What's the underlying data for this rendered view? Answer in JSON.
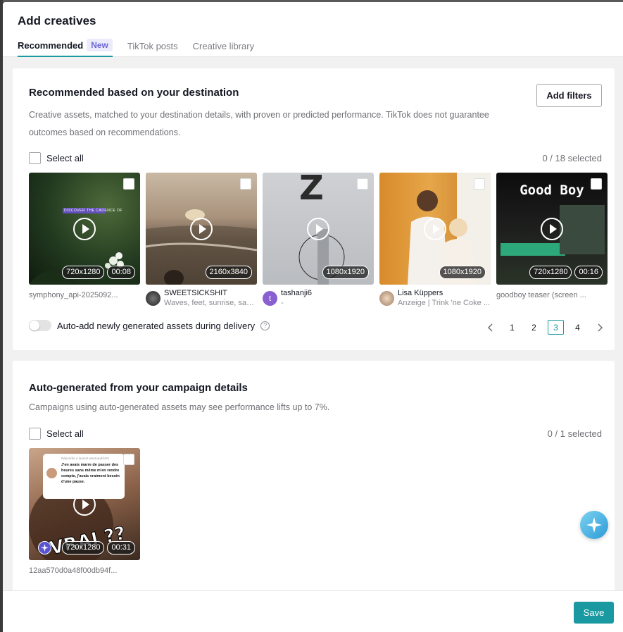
{
  "modal": {
    "title": "Add creatives",
    "tabs": [
      {
        "label": "Recommended",
        "badge": "New",
        "active": true
      },
      {
        "label": "TikTok posts"
      },
      {
        "label": "Creative library"
      }
    ]
  },
  "recommended": {
    "title": "Recommended based on your destination",
    "description": "Creative assets, matched to your destination details, with proven or predicted performance. TikTok does not guarantee outcomes based on recommendations.",
    "add_filters_label": "Add filters",
    "select_all_label": "Select all",
    "selected_count": "0 / 18 selected",
    "items": [
      {
        "resolution": "720x1280",
        "duration": "00:08",
        "name": "symphony_api-2025092..."
      },
      {
        "resolution": "2160x3840",
        "author": "SWEETSICKSHIT",
        "caption": "Waves, feet, sunrise, san..."
      },
      {
        "resolution": "1080x1920",
        "author": "tashanji6",
        "caption": "-",
        "avatar_letter": "t"
      },
      {
        "resolution": "1080x1920",
        "author": "Lisa Küppers",
        "caption": "Anzeige | Trink 'ne Coke ..."
      },
      {
        "resolution": "720x1280",
        "duration": "00:16",
        "name": "goodboy teaser (screen ..."
      }
    ],
    "overlay_text": {
      "item0": "DISCOVER THE CADENCE OF",
      "item4_headline": "Good Boy",
      "item2_letter": "Z"
    },
    "auto_add_label": "Auto-add newly generated assets during delivery",
    "pagination": {
      "pages": [
        "1",
        "2",
        "3",
        "4"
      ],
      "current": "3"
    }
  },
  "autogen": {
    "title": "Auto-generated from your campaign details",
    "description": "Campaigns using auto-generated assets may see performance lifts up to 7%.",
    "select_all_label": "Select all",
    "selected_count": "0 / 1 selected",
    "items": [
      {
        "resolution": "720x1280",
        "duration": "00:31",
        "name": "12aa570d0a48f00db94f...",
        "bubble_reply": "Répondre à laurent.wantorpdd431",
        "bubble_text": "J'en avais marre de passer des heures sans même m'en rendre compte, j'avais vraiment besoin d'une pause.",
        "big_text": "VRAI ??"
      }
    ]
  },
  "footer": {
    "save_label": "Save"
  },
  "colors": {
    "accent": "#1a9aa0",
    "badge_text": "#6b67d6",
    "badge_bg": "#ecebfb",
    "ai_badge": "#5b55d4"
  },
  "icons": [
    "play-icon",
    "chevron-left-icon",
    "chevron-right-icon",
    "help-icon",
    "sparkle-icon",
    "assistant-icon"
  ]
}
